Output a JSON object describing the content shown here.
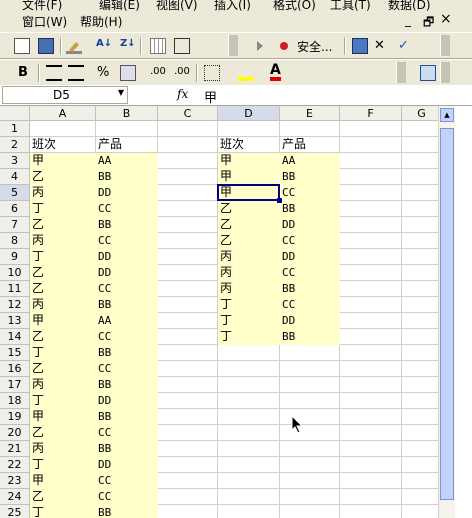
{
  "menu": {
    "row1": [
      "文件(F)",
      "编辑(E)",
      "视图(V)",
      "插入(I)",
      "格式(O)",
      "工具(T)",
      "数据(D)"
    ],
    "row2": [
      "窗口(W)",
      "帮助(H)"
    ],
    "window_controls": [
      "_",
      "🗗",
      "×"
    ]
  },
  "toolbar_standard": {
    "security_label": "安全..."
  },
  "toolbar_format": {
    "bold": "B",
    "percent": "%",
    "inc_dec": ".00",
    "font_color_letter": "A"
  },
  "formula_bar": {
    "name_box": "D5",
    "fx": "fx",
    "value": "甲"
  },
  "columns": [
    "A",
    "B",
    "C",
    "D",
    "E",
    "F",
    "G"
  ],
  "rows": [
    "1",
    "2",
    "3",
    "4",
    "5",
    "6",
    "7",
    "8",
    "9",
    "10",
    "11",
    "12",
    "13",
    "14",
    "15",
    "16",
    "17",
    "18",
    "19",
    "20",
    "21",
    "22",
    "23",
    "24",
    "25"
  ],
  "headers": {
    "A2": "班次",
    "B2": "产品",
    "D2": "班次",
    "E2": "产品"
  },
  "data_left": [
    [
      "甲",
      "AA"
    ],
    [
      "乙",
      "BB"
    ],
    [
      "丙",
      "DD"
    ],
    [
      "丁",
      "CC"
    ],
    [
      "乙",
      "BB"
    ],
    [
      "丙",
      "CC"
    ],
    [
      "丁",
      "DD"
    ],
    [
      "乙",
      "DD"
    ],
    [
      "乙",
      "CC"
    ],
    [
      "丙",
      "BB"
    ],
    [
      "甲",
      "AA"
    ],
    [
      "乙",
      "CC"
    ],
    [
      "丁",
      "BB"
    ],
    [
      "乙",
      "CC"
    ],
    [
      "丙",
      "BB"
    ],
    [
      "丁",
      "DD"
    ],
    [
      "甲",
      "BB"
    ],
    [
      "乙",
      "CC"
    ],
    [
      "丙",
      "BB"
    ],
    [
      "丁",
      "DD"
    ],
    [
      "甲",
      "CC"
    ],
    [
      "乙",
      "CC"
    ],
    [
      "丁",
      "BB"
    ]
  ],
  "data_right": [
    [
      "甲",
      "AA"
    ],
    [
      "甲",
      "BB"
    ],
    [
      "甲",
      "CC"
    ],
    [
      "乙",
      "BB"
    ],
    [
      "乙",
      "DD"
    ],
    [
      "乙",
      "CC"
    ],
    [
      "丙",
      "DD"
    ],
    [
      "丙",
      "CC"
    ],
    [
      "丙",
      "BB"
    ],
    [
      "丁",
      "CC"
    ],
    [
      "丁",
      "DD"
    ],
    [
      "丁",
      "BB"
    ]
  ],
  "selected_cell": "D5",
  "colors": {
    "highlight": "#ffffcc",
    "selection_border": "#000080"
  }
}
